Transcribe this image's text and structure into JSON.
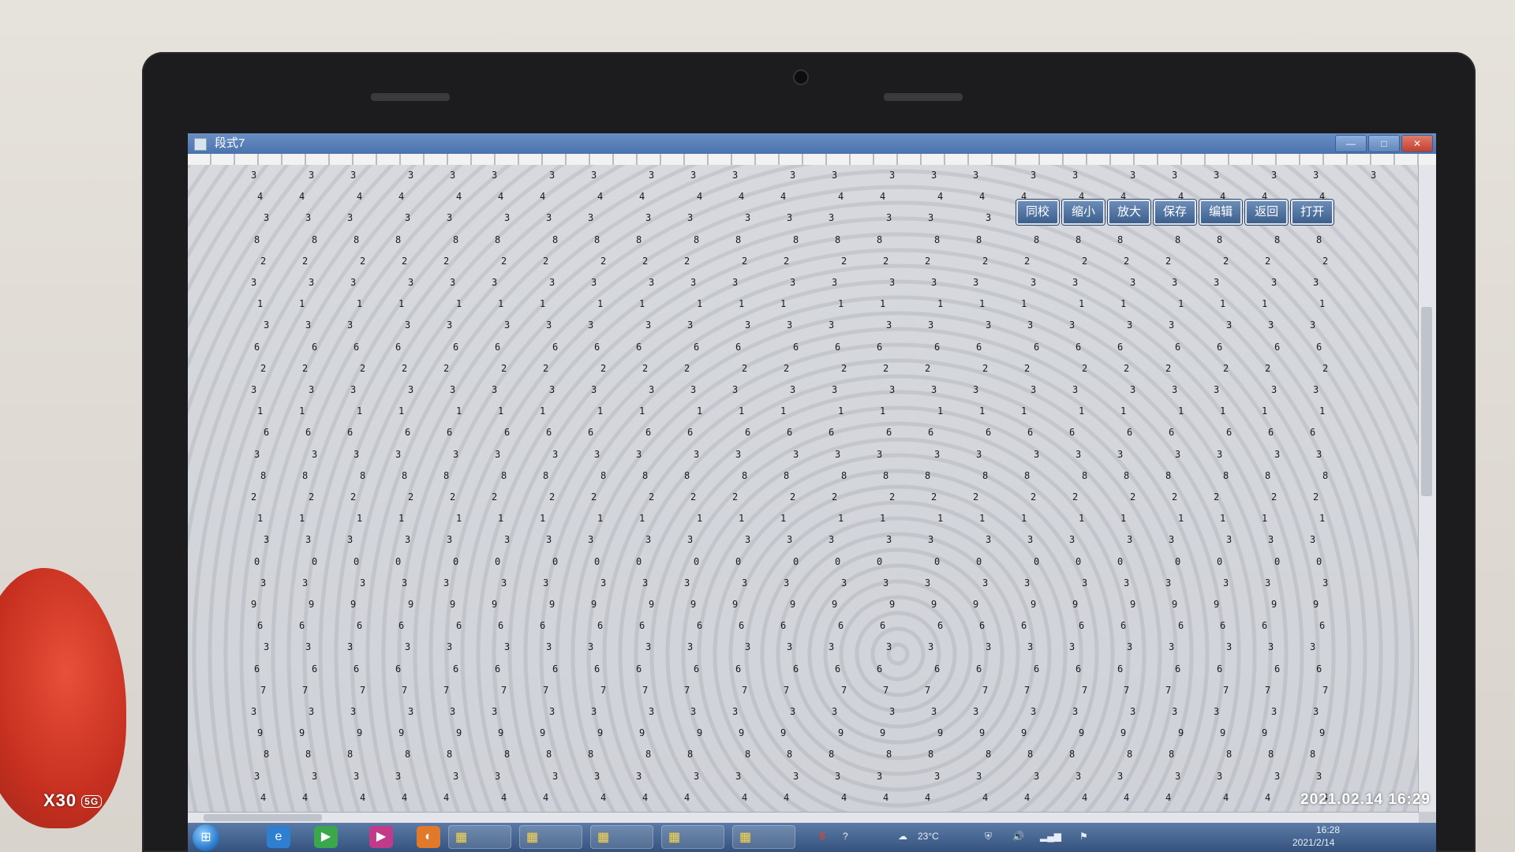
{
  "window": {
    "title": "段式7",
    "buttons": {
      "minimize": "—",
      "maximize": "□",
      "close": "✕"
    }
  },
  "toolbar": [
    "同校",
    "缩小",
    "放大",
    "保存",
    "编辑",
    "返回",
    "打开"
  ],
  "grid_rows": [
    "3 3 3 3 3 3 3 3 3 3 3 3 3 3 3 3 3 3 3 3 3 3 3 3",
    "4 4 4 4 4 4 4 4 4 4 4 4 4 4 4 4 4 4 4 4 4 4 4",
    "3 3 3 3 3 3 3 3 3 3 3 3 3 3 3 3 3 3 3 3 3 3 3",
    "8 8 8 8 8 8 8 8 8 8 8 8 8 8 8 8 8 8 8 8 8 8 8",
    "2 2 2 2 2 2 2 2 2 2 2 2 2 2 2 2 2 2 2 2 2 2 2",
    "3 3 3 3 3 3 3 3 3 3 3 3 3 3 3 3 3 3 3 3 3 3 3",
    "1 1 1 1 1 1 1 1 1 1 1 1 1 1 1 1 1 1 1 1 1 1 1",
    "3 3 3 3 3 3 3 3 3 3 3 3 3 3 3 3 3 3 3 3 3 3 3",
    "6 6 6 6 6 6 6 6 6 6 6 6 6 6 6 6 6 6 6 6 6 6 6",
    "2 2 2 2 2 2 2 2 2 2 2 2 2 2 2 2 2 2 2 2 2 2 2",
    "3 3 3 3 3 3 3 3 3 3 3 3 3 3 3 3 3 3 3 3 3 3 3",
    "1 1 1 1 1 1 1 1 1 1 1 1 1 1 1 1 1 1 1 1 1 1 1",
    "6 6 6 6 6 6 6 6 6 6 6 6 6 6 6 6 6 6 6 6 6 6 6",
    "3 3 3 3 3 3 3 3 3 3 3 3 3 3 3 3 3 3 3 3 3 3 3",
    "8 8 8 8 8 8 8 8 8 8 8 8 8 8 8 8 8 8 8 8 8 8 8",
    "2 2 2 2 2 2 2 2 2 2 2 2 2 2 2 2 2 2 2 2 2 2 2",
    "1 1 1 1 1 1 1 1 1 1 1 1 1 1 1 1 1 1 1 1 1 1 1",
    "3 3 3 3 3 3 3 3 3 3 3 3 3 3 3 3 3 3 3 3 3 3 3",
    "0 0 0 0 0 0 0 0 0 0 0 0 0 0 0 0 0 0 0 0 0 0 0",
    "3 3 3 3 3 3 3 3 3 3 3 3 3 3 3 3 3 3 3 3 3 3 3",
    "9 9 9 9 9 9 9 9 9 9 9 9 9 9 9 9 9 9 9 9 9 9 9",
    "6 6 6 6 6 6 6 6 6 6 6 6 6 6 6 6 6 6 6 6 6 6 6",
    "3 3 3 3 3 3 3 3 3 3 3 3 3 3 3 3 3 3 3 3 3 3 3",
    "6 6 6 6 6 6 6 6 6 6 6 6 6 6 6 6 6 6 6 6 6 6 6",
    "7 7 7 7 7 7 7 7 7 7 7 7 7 7 7 7 7 7 7 7 7 7 7",
    "3 3 3 3 3 3 3 3 3 3 3 3 3 3 3 3 3 3 3 3 3 3 3",
    "9 9 9 9 9 9 9 9 9 9 9 9 9 9 9 9 9 9 9 9 9 9 9",
    "8 8 8 8 8 8 8 8 8 8 8 8 8 8 8 8 8 8 8 8 8 8 8",
    "3 3 3 3 3 3 3 3 3 3 3 3 3 3 3 3 3 3 3 3 3 3 3",
    "4 4 4 4 4 4 4 4 4 4 4 4 4 4 4 4 4 4 4 4 4 4 4"
  ],
  "taskbar": {
    "start": "⊞",
    "tasks": [
      "▦",
      "▦",
      "▦",
      "▦",
      "▦"
    ],
    "tray": {
      "temp": "23°C",
      "time": "16:28",
      "date": "2021/2/14"
    }
  },
  "photo_stamp": {
    "device": "X30",
    "network": "5G",
    "datetime": "2021.02.14 16:29"
  }
}
